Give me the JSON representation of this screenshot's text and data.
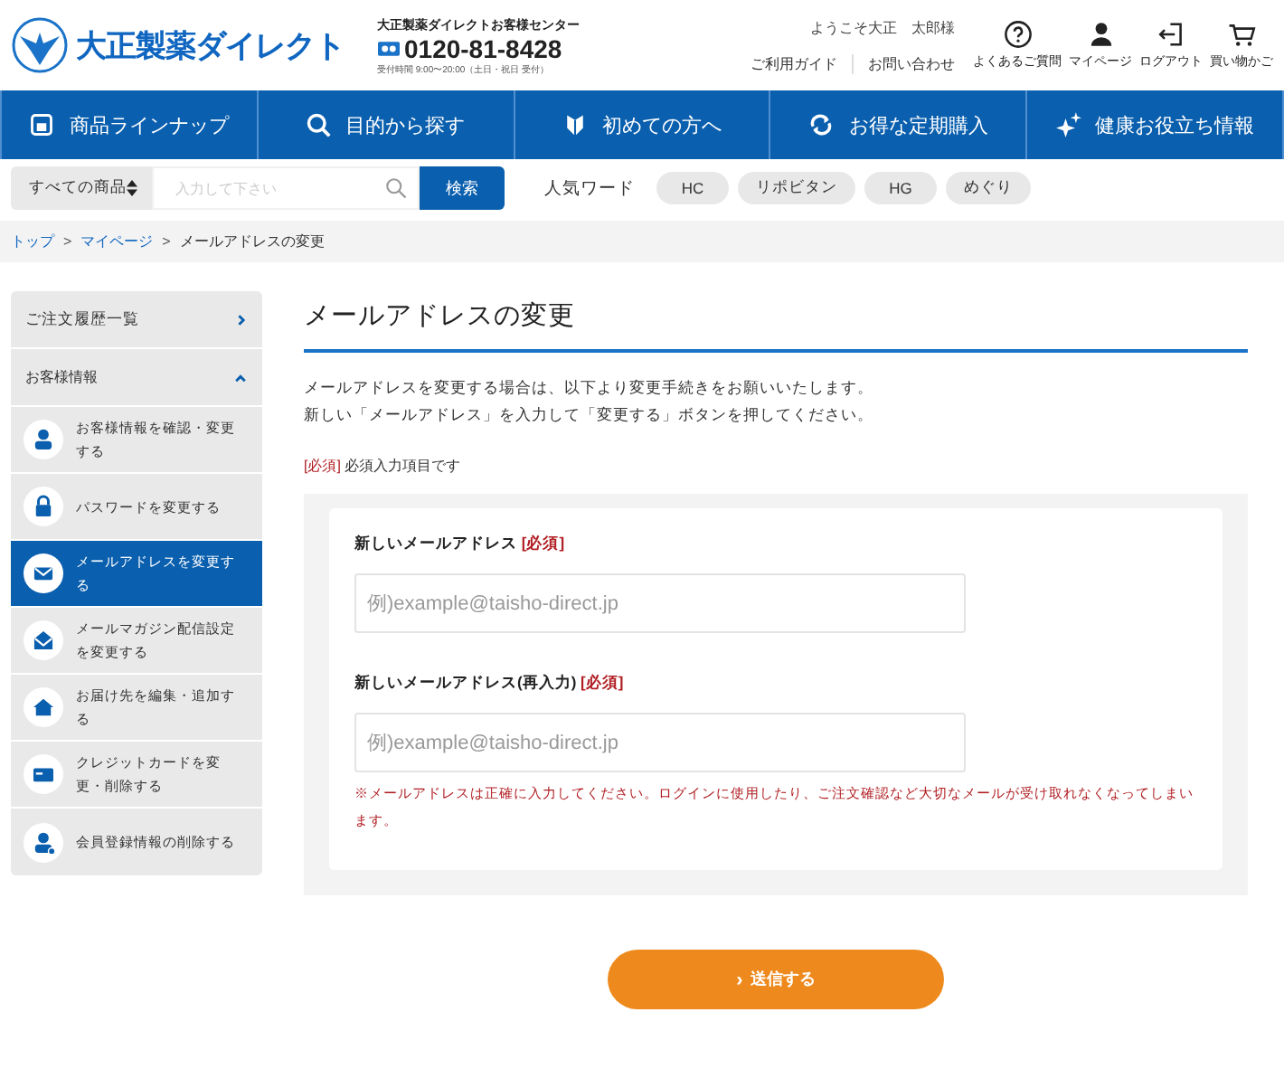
{
  "header": {
    "logo": "大正製薬ダイレクト",
    "call_center": {
      "label": "大正製薬ダイレクトお客様センター",
      "phone": "0120-81-8428",
      "hours": "受付時間 9:00〜20:00（土日・祝日 受付）"
    },
    "welcome": "ようこそ大正　太郎様",
    "links": [
      "ご利用ガイド",
      "お問い合わせ"
    ],
    "icons": [
      {
        "kind": "help",
        "label": "よくあるご質問"
      },
      {
        "kind": "user",
        "label": "マイページ"
      },
      {
        "kind": "logout",
        "label": "ログアウト"
      },
      {
        "kind": "cart",
        "label": "買い物かご"
      }
    ]
  },
  "nav": [
    {
      "kind": "cup",
      "label": "商品ラインナップ"
    },
    {
      "kind": "search",
      "label": "目的から探す"
    },
    {
      "kind": "leaf",
      "label": "初めての方へ"
    },
    {
      "kind": "cycle",
      "label": "お得な定期購入"
    },
    {
      "kind": "sparkle",
      "label": "健康お役立ち情報"
    }
  ],
  "search": {
    "category": "すべての商品",
    "placeholder": "入力して下さい",
    "button": "検索",
    "popular_label": "人気ワード",
    "popular": [
      "HC",
      "リポビタン",
      "HG",
      "めぐり"
    ]
  },
  "breadcrumb": {
    "separator": ">",
    "items": [
      {
        "label": "トップ",
        "link": true
      },
      {
        "label": "マイページ",
        "link": true
      },
      {
        "label": "メールアドレスの変更",
        "link": false
      }
    ]
  },
  "sidebar": [
    {
      "label": "ご注文履歴一覧",
      "expanded": false
    },
    {
      "label": "お客様情報",
      "expanded": true,
      "children": [
        {
          "kind": "user",
          "label": "お客様情報を確認・変更する",
          "selected": false
        },
        {
          "kind": "lock",
          "label": "パスワードを変更する",
          "selected": false
        },
        {
          "kind": "mail",
          "label": "メールアドレスを変更する",
          "selected": true
        },
        {
          "kind": "magazine",
          "label": "メールマガジン配信設定を変更する",
          "selected": false
        },
        {
          "kind": "home",
          "label": "お届け先を編集・追加する",
          "selected": false
        },
        {
          "kind": "card",
          "label": "クレジットカードを変更・削除する",
          "selected": false
        },
        {
          "kind": "userdel",
          "label": "会員登録情報の削除する",
          "selected": false
        }
      ]
    }
  ],
  "main": {
    "title": "メールアドレスの変更",
    "intro": [
      "メールアドレスを変更する場合は、以下より変更手続きをお願いいたします。",
      "新しい「メールアドレス」を入力して「変更する」ボタンを押してください。"
    ],
    "required_note": {
      "tag": "[必須]",
      "text": "必須入力項目です"
    },
    "fields": [
      {
        "label": "新しいメールアドレス",
        "required": "[必須]",
        "placeholder": "例)example@taisho-direct.jp"
      },
      {
        "label": "新しいメールアドレス(再入力)",
        "required": "[必須]",
        "placeholder": "例)example@taisho-direct.jp"
      }
    ],
    "warning": "※メールアドレスは正確に入力してください。ログインに使用したり、ご注文確認など大切なメールが受け取れなくなってしまいます。",
    "submit": {
      "icon": "›",
      "label": "送信する"
    }
  }
}
